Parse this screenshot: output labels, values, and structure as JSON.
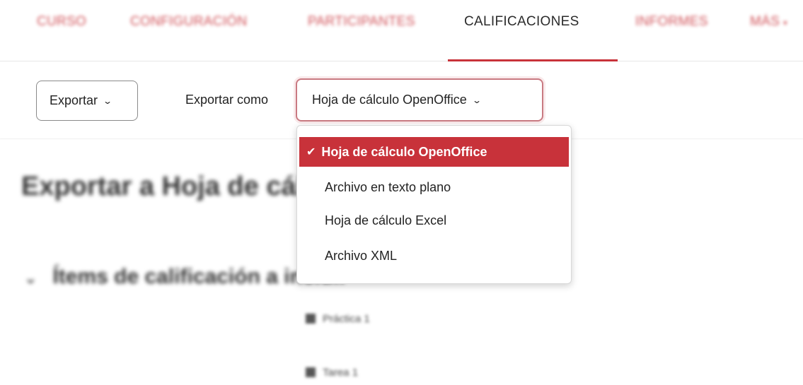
{
  "nav": {
    "tabs": [
      {
        "label": "Curso",
        "active": false
      },
      {
        "label": "Configuración",
        "active": false
      },
      {
        "label": "Participantes",
        "active": false
      },
      {
        "label": "Calificaciones",
        "active": true
      },
      {
        "label": "Informes",
        "active": false
      },
      {
        "label": "Más",
        "active": false
      }
    ]
  },
  "toolbar": {
    "export_label": "Exportar",
    "export_as_label": "Exportar como",
    "selected_format": "Hoja de cálculo OpenOffice"
  },
  "dropdown": {
    "options": [
      {
        "label": "Hoja de cálculo OpenOffice",
        "selected": true
      },
      {
        "label": "Archivo en texto plano",
        "selected": false
      },
      {
        "label": "Hoja de cálculo Excel",
        "selected": false
      },
      {
        "label": "Archivo XML",
        "selected": false
      }
    ]
  },
  "page": {
    "heading": "Exportar a Hoja de cálculo OpenOffice",
    "section_heading": "Ítems de calificación a incluir",
    "items": [
      "Práctica 1",
      "Tarea 1"
    ]
  },
  "colors": {
    "accent": "#c8323a",
    "selected_text": "#ffffff"
  },
  "icons": {
    "dropdown_chevron": "chevron-down-icon",
    "selected_check": "check-icon",
    "section_toggle": "chevron-down-icon"
  }
}
